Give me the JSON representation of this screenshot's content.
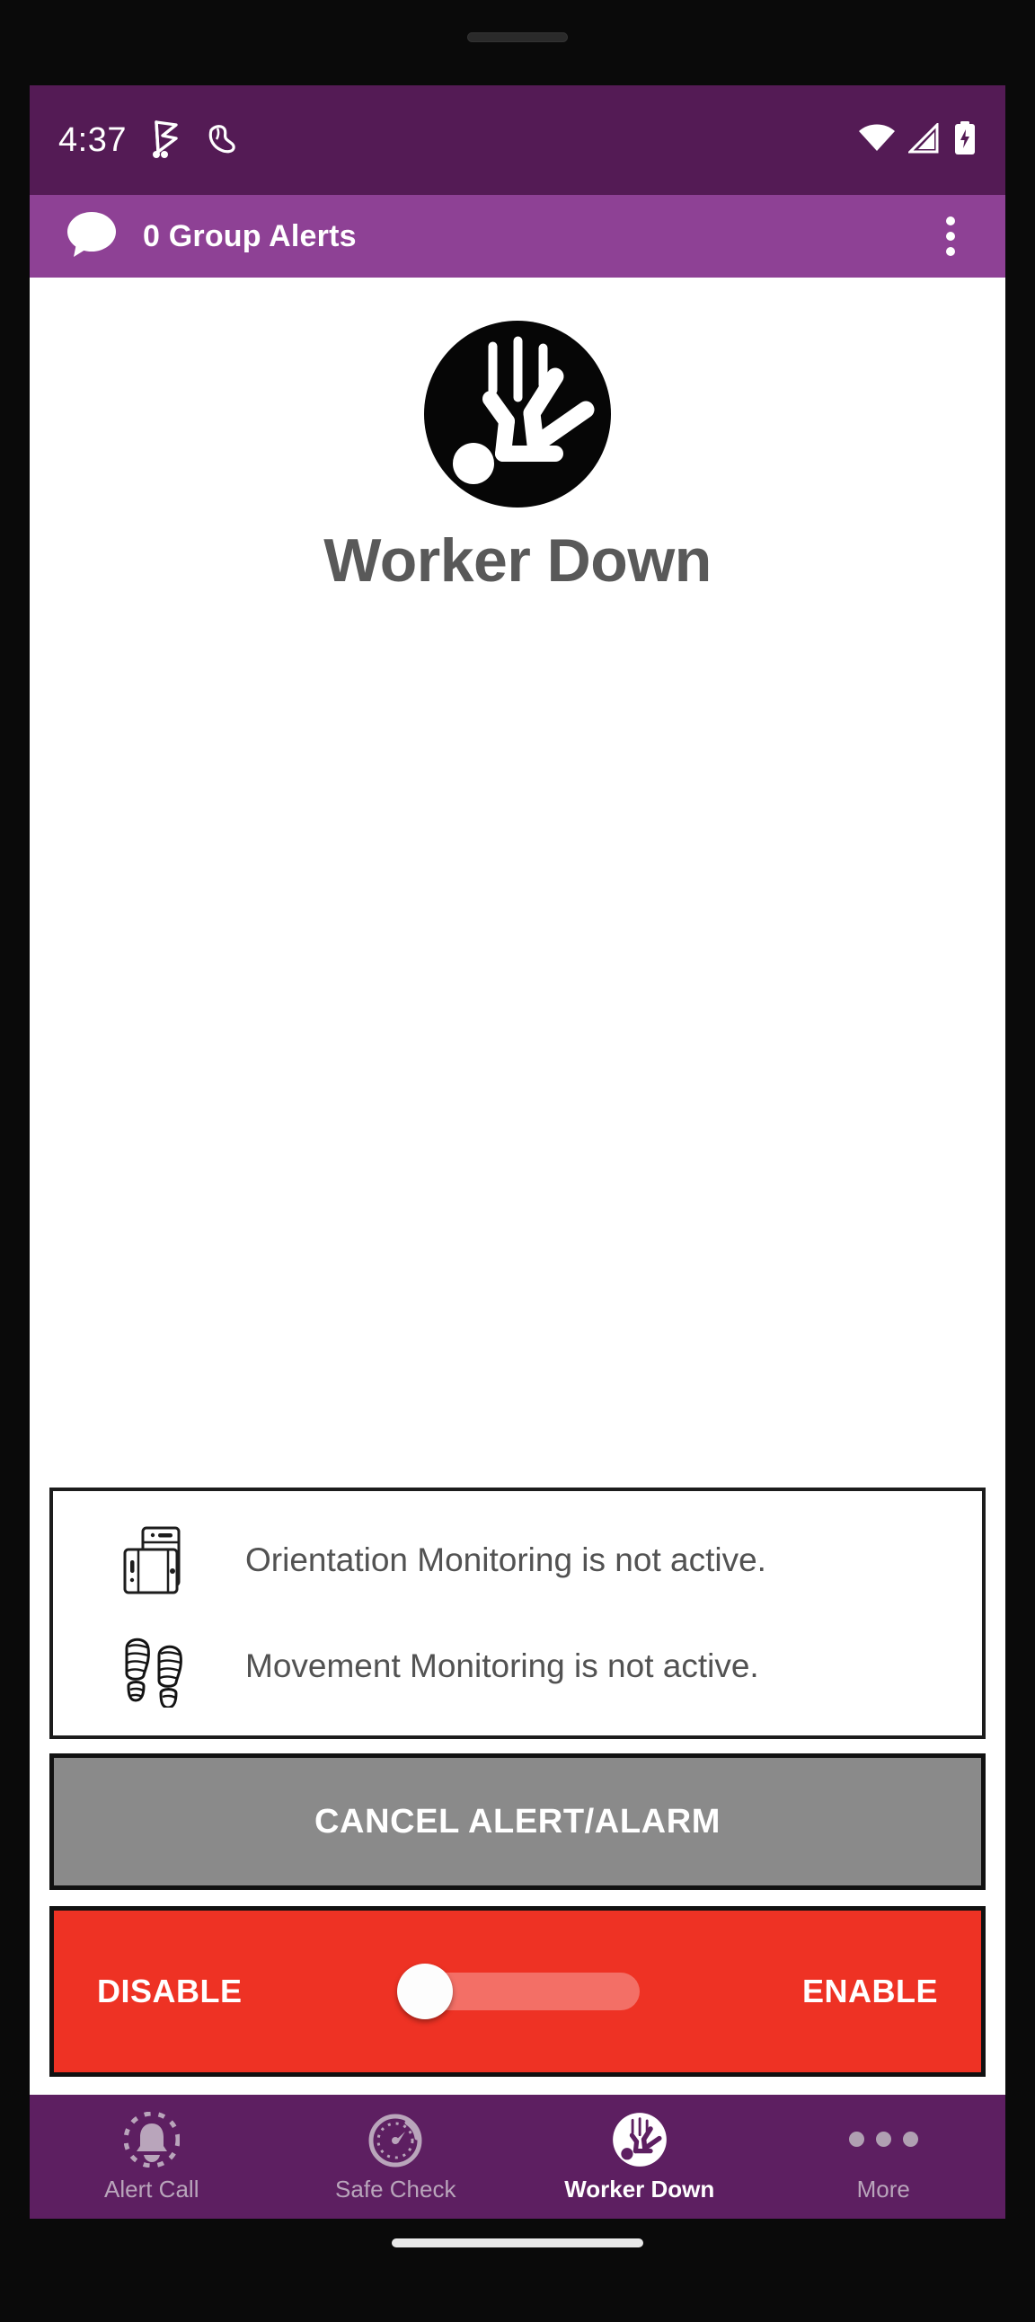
{
  "status_bar": {
    "time": "4:37",
    "icons_left": [
      "flag-icon",
      "shoe-icon"
    ],
    "icons_right": [
      "wifi-icon",
      "cellular-signal-icon",
      "battery-charging-icon"
    ],
    "background_color": "#541b55"
  },
  "app_bar": {
    "chat_icon": "speech-bubble-icon",
    "title": "0 Group Alerts",
    "overflow_icon": "more-vertical-icon",
    "background_color": "#8e4195"
  },
  "hero": {
    "icon": "worker-down-icon",
    "title": "Worker Down",
    "title_color": "#595959"
  },
  "monitoring": {
    "rows": [
      {
        "icon": "device-orientation-icon",
        "text": "Orientation Monitoring is not active."
      },
      {
        "icon": "footprints-icon",
        "text": "Movement Monitoring is not active."
      }
    ]
  },
  "cancel_button": {
    "label": "CANCEL ALERT/ALARM",
    "background_color": "#8a8a8a",
    "text_color": "#ffffff"
  },
  "toggle": {
    "left_label": "DISABLE",
    "right_label": "ENABLE",
    "state": "disabled",
    "background_color": "#ee3224",
    "thumb_color": "#fdfdfd"
  },
  "bottom_nav": {
    "background_color": "#5d1f61",
    "items": [
      {
        "label": "Alert Call",
        "icon": "bell-alert-icon",
        "active": false
      },
      {
        "label": "Safe Check",
        "icon": "timer-gauge-icon",
        "active": false
      },
      {
        "label": "Worker Down",
        "icon": "worker-down-icon",
        "active": true
      },
      {
        "label": "More",
        "icon": "more-horizontal-icon",
        "active": false
      }
    ]
  }
}
